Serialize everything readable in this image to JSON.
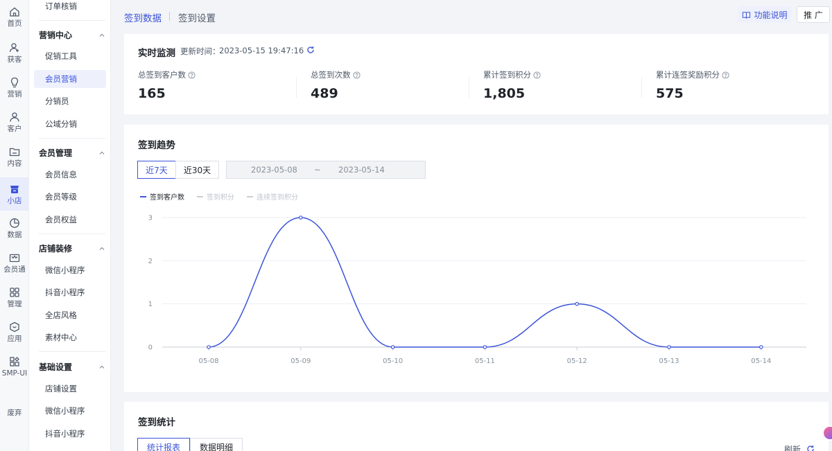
{
  "rail": [
    {
      "label": "首页",
      "icon": "home-icon"
    },
    {
      "label": "获客",
      "icon": "user-add-icon"
    },
    {
      "label": "营销",
      "icon": "bulb-icon"
    },
    {
      "label": "客户",
      "icon": "user-icon"
    },
    {
      "label": "内容",
      "icon": "folder-icon"
    },
    {
      "label": "小店",
      "icon": "shop-icon",
      "active": true
    },
    {
      "label": "数据",
      "icon": "pie-icon"
    },
    {
      "label": "会员通",
      "icon": "crown-icon"
    },
    {
      "label": "管理",
      "icon": "grid-icon"
    },
    {
      "label": "应用",
      "icon": "app-icon"
    },
    {
      "label": "SMP-UI",
      "icon": "components-icon"
    },
    {
      "label": "废弃",
      "icon": ""
    }
  ],
  "menu": {
    "top_item": "订单核销",
    "groups": [
      {
        "title": "营销中心",
        "items": [
          "促销工具",
          "会员营销",
          "分销员",
          "公域分销"
        ]
      },
      {
        "title": "会员管理",
        "items": [
          "会员信息",
          "会员等级",
          "会员权益"
        ]
      },
      {
        "title": "店铺装修",
        "items": [
          "微信小程序",
          "抖音小程序",
          "全店风格",
          "素材中心"
        ]
      },
      {
        "title": "基础设置",
        "items": [
          "店铺设置",
          "微信小程序",
          "抖音小程序"
        ]
      }
    ],
    "active_item": "会员营销"
  },
  "topbar": {
    "tab_active": "签到数据",
    "tab_inactive": "签到设置",
    "help_label": "功能说明",
    "promo_label": "推 广"
  },
  "monitor": {
    "title": "实时监测",
    "updated_label": "更新时间：",
    "updated_time": "2023-05-15 19:47:16",
    "metrics": [
      {
        "label": "总签到客户数",
        "value": "165"
      },
      {
        "label": "总签到次数",
        "value": "489"
      },
      {
        "label": "累计签到积分",
        "value": "1,805"
      },
      {
        "label": "累计连签奖励积分",
        "value": "575"
      }
    ]
  },
  "trend": {
    "title": "签到趋势",
    "range_7": "近7天",
    "range_30": "近30天",
    "date_start": "2023-05-08",
    "date_sep": "~",
    "date_end": "2023-05-14",
    "legend": [
      "签到客户数",
      "签到积分",
      "连续签到积分"
    ]
  },
  "chart_data": {
    "type": "line",
    "x": [
      "05-08",
      "05-09",
      "05-10",
      "05-11",
      "05-12",
      "05-13",
      "05-14"
    ],
    "series": [
      {
        "name": "签到客户数",
        "values": [
          0,
          3,
          0,
          0,
          1,
          0,
          0
        ]
      }
    ],
    "yticks": [
      0,
      1,
      2,
      3
    ],
    "ylim": [
      0,
      3
    ],
    "grid": true,
    "legend_position": "top-left",
    "color": "#3b54d9"
  },
  "stats": {
    "title": "签到统计",
    "tab_active": "统计报表",
    "tab_inactive": "数据明细",
    "refresh_label": "刷新"
  }
}
